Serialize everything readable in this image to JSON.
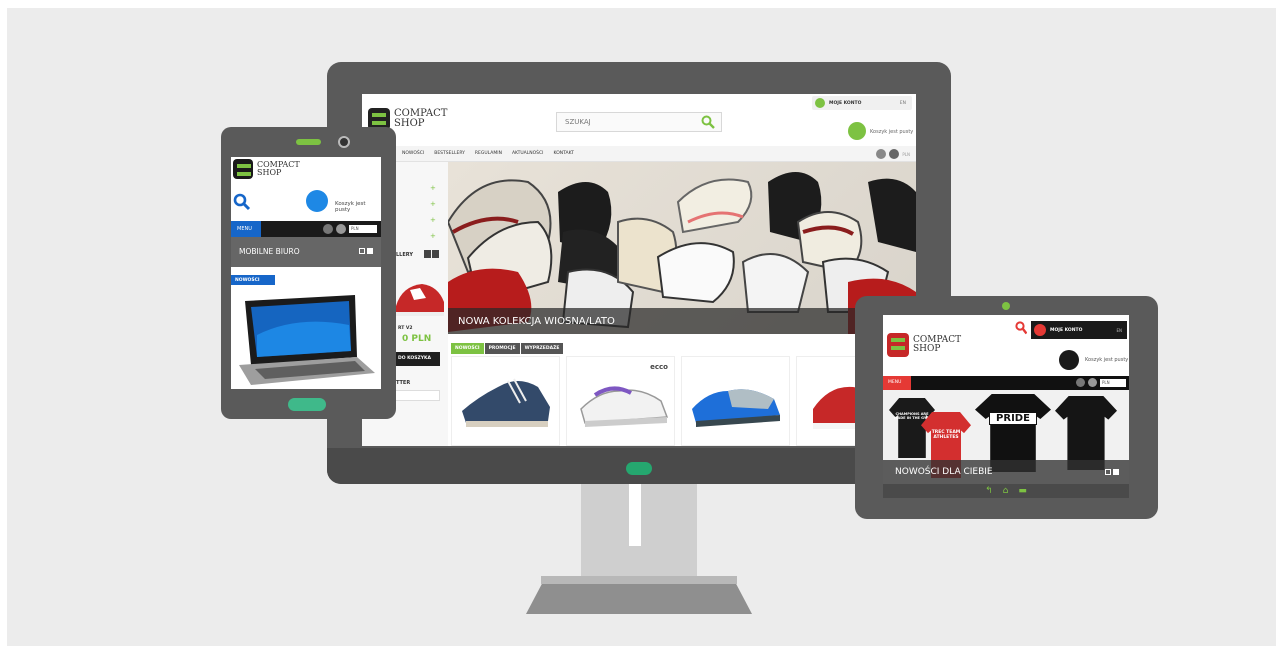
{
  "desktop": {
    "logo": {
      "line1": "COMPACT",
      "line2": "SHOP"
    },
    "search_placeholder": "SZUKAJ",
    "account_label": "MOJE KONTO",
    "lang": "EN",
    "cart_status": "Koszyk jest pusty",
    "nav": [
      "NOWOŚCI",
      "BESTSELLERY",
      "REGULAMIN",
      "AKTUALNOŚCI",
      "KONTAKT"
    ],
    "currency": "PLN",
    "sidebar": {
      "bestsellers_heading": "LLERY",
      "product_model": "RT V2",
      "price": "0 PLN",
      "add_to_cart": "DO KOSZYKA",
      "newsletter_heading": "TTER"
    },
    "hero_caption": "NOWA KOLEKCJA WIOSNA/LATO",
    "tabs": [
      "NOWOŚCI",
      "PROMOCJE",
      "WYPRZEDAŻE"
    ],
    "product_brand_logo": "ecco",
    "colors": {
      "accent": "#7dc242"
    }
  },
  "phone": {
    "logo": {
      "line1": "COMPACT",
      "line2": "SHOP"
    },
    "cart_status": "Koszyk jest pusty",
    "menu_label": "MENU",
    "currency": "PLN",
    "category": "MOBILNE BIURO",
    "badge": "NOWOŚCI",
    "colors": {
      "accent": "#1666c9"
    }
  },
  "tablet": {
    "logo": {
      "line1": "COMPACT",
      "line2": "SHOP"
    },
    "account_label": "MOJE KONTO",
    "lang": "EN",
    "cart_status": "Koszyk jest pusty",
    "menu_label": "MENU",
    "currency": "PLN",
    "hero_caption": "NOWOŚCI DLA CIEBIE",
    "tee_texts": [
      "CHAMPIONS ARE MADE IN THE GYM",
      "TREC TEAM ATHLETES",
      "PRIDE"
    ],
    "colors": {
      "accent": "#e53935"
    }
  }
}
